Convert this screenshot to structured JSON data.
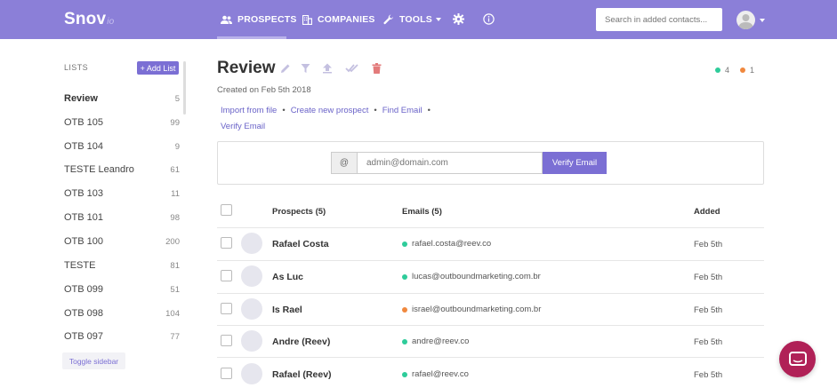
{
  "app": {
    "logo": "Snov",
    "logo_suffix": "io"
  },
  "nav": {
    "prospects": "PROSPECTS",
    "companies": "COMPANIES",
    "tools": "TOOLS",
    "search_placeholder": "Search in added contacts..."
  },
  "sidebar": {
    "lists_label": "LISTS",
    "add_list": "+ Add List",
    "items": [
      {
        "name": "Review",
        "count": "5"
      },
      {
        "name": "OTB 105",
        "count": "99"
      },
      {
        "name": "OTB 104",
        "count": "9"
      },
      {
        "name": "TESTE Leandro",
        "count": "61"
      },
      {
        "name": "OTB 103",
        "count": "11"
      },
      {
        "name": "OTB 101",
        "count": "98"
      },
      {
        "name": "OTB 100",
        "count": "200"
      },
      {
        "name": "TESTE",
        "count": "81"
      },
      {
        "name": "OTB 099",
        "count": "51"
      },
      {
        "name": "OTB 098",
        "count": "104"
      },
      {
        "name": "OTB 097",
        "count": "77"
      }
    ],
    "toggle": "Toggle sidebar"
  },
  "list": {
    "title": "Review",
    "created": "Created on Feb 5th 2018",
    "stats": {
      "green": "4",
      "orange": "1"
    },
    "actions": {
      "import": "Import from file",
      "create": "Create new prospect",
      "find": "Find Email",
      "verify": "Verify Email"
    }
  },
  "verify": {
    "at": "@",
    "placeholder": "admin@domain.com",
    "button": "Verify Email"
  },
  "table": {
    "headers": {
      "prospects": "Prospects (5)",
      "emails": "Emails (5)",
      "added": "Added"
    },
    "rows": [
      {
        "name": "Rafael Costa",
        "email": "rafael.costa@reev.co",
        "status": "green",
        "added": "Feb 5th"
      },
      {
        "name": "As Luc",
        "email": "lucas@outboundmarketing.com.br",
        "status": "green",
        "added": "Feb 5th"
      },
      {
        "name": "Is Rael",
        "email": "israel@outboundmarketing.com.br",
        "status": "orange",
        "added": "Feb 5th"
      },
      {
        "name": "Andre (Reev)",
        "email": "andre@reev.co",
        "status": "green",
        "added": "Feb 5th"
      },
      {
        "name": "Rafael (Reev)",
        "email": "rafael@reev.co",
        "status": "green",
        "added": "Feb 5th"
      }
    ]
  },
  "colors": {
    "primary": "#8b7fd8",
    "button": "#7b6fd4",
    "green": "#2ecc9a",
    "orange": "#f0883e",
    "chat": "#b02157"
  },
  "icons": [
    "users-icon",
    "building-icon",
    "wrench-icon",
    "gear-icon",
    "info-icon",
    "edit-icon",
    "filter-icon",
    "upload-icon",
    "double-check-icon",
    "trash-icon",
    "chat-icon"
  ]
}
